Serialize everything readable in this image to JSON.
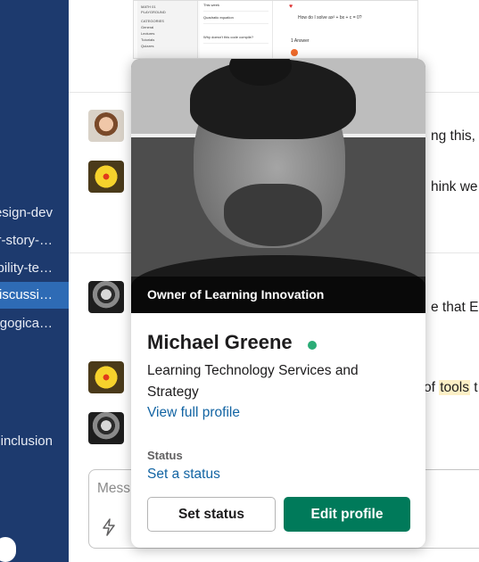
{
  "sidebar": {
    "items": [
      {
        "label": "design-dev",
        "active": false
      },
      {
        "label": "user-story-…",
        "active": false
      },
      {
        "label": "accessibility-te…",
        "active": false
      },
      {
        "label": "ed-discussi…",
        "active": true
      },
      {
        "label": "pedagogica…",
        "active": false
      },
      {
        "label": "inclusion",
        "active": false
      }
    ]
  },
  "messages": {
    "snippet_1": "ng this, b",
    "snippet_2": "hink we c",
    "snippet_3": "e that Ed",
    "snippet_4_prefix": "of ",
    "snippet_4_highlight": "tools",
    "snippet_4_suffix": " t"
  },
  "attachment": {
    "sidebar_lines": [
      "MATH 01",
      "PLAYGROUND",
      "CATEGORIES",
      "General",
      "Lectures",
      "Tutorials",
      "Quizzes"
    ],
    "list_header": "This week",
    "list_rows": [
      "Quadratic equation",
      "Why doesn't this code compile?"
    ],
    "question": "How do I solve ax² + bx + c = 0?",
    "answers_label": "1 Answer"
  },
  "composer": {
    "placeholder": "Mess"
  },
  "profile": {
    "caption": "Owner of Learning Innovation",
    "name": "Michael Greene",
    "title": "Learning Technology Services and Strategy",
    "view_profile": "View full profile",
    "status_label": "Status",
    "set_status_link": "Set a status",
    "btn_set_status": "Set status",
    "btn_edit_profile": "Edit profile",
    "presence": "active"
  },
  "colors": {
    "sidebar_bg": "#1d3a6e",
    "sidebar_active": "#2e6bb5",
    "link": "#1264a3",
    "primary_button": "#007a5a",
    "presence": "#2bac76",
    "highlight": "#fdf0c6"
  }
}
